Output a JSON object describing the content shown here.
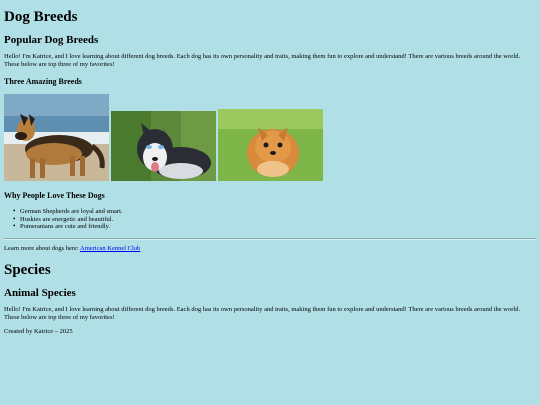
{
  "page": {
    "title": "Dog Breeds",
    "subtitle": "Popular Dog Breeds",
    "intro": "Hello! I'm Katrice, and I love learning about different dog breeds. Each dog has its own personality and traits, making them fun to explore and understand! There are various breeds around the world. These below are top three of my favorites!",
    "breeds_heading": "Three Amazing Breeds",
    "images": [
      {
        "alt": "German Shepherd",
        "icon": "german-shepherd-photo"
      },
      {
        "alt": "Siberian Husky",
        "icon": "husky-photo"
      },
      {
        "alt": "Pomeranian",
        "icon": "pomeranian-photo"
      }
    ],
    "love_heading": "Why People Love These Dogs",
    "love_items": [
      "German Shepherds are loyal and smart.",
      "Huskies are energetic and beautiful.",
      "Pomeranians are cute and friendly."
    ],
    "learn_more_text": "Learn more about dogs here: ",
    "learn_more_link": "American Kennel Club"
  },
  "species": {
    "title": "Species",
    "subtitle": "Animal Species",
    "intro": "Hello! I'm Katrice, and I love learning about different dog breeds. Each dog has its own personality and traits, making them fun to explore and understand! There are various breeds around the world. These below are top three of my favorites!",
    "footer": "Created by Katrice – 2025"
  },
  "colors": {
    "background": "#b0e0e6",
    "link": "#0000ee"
  }
}
